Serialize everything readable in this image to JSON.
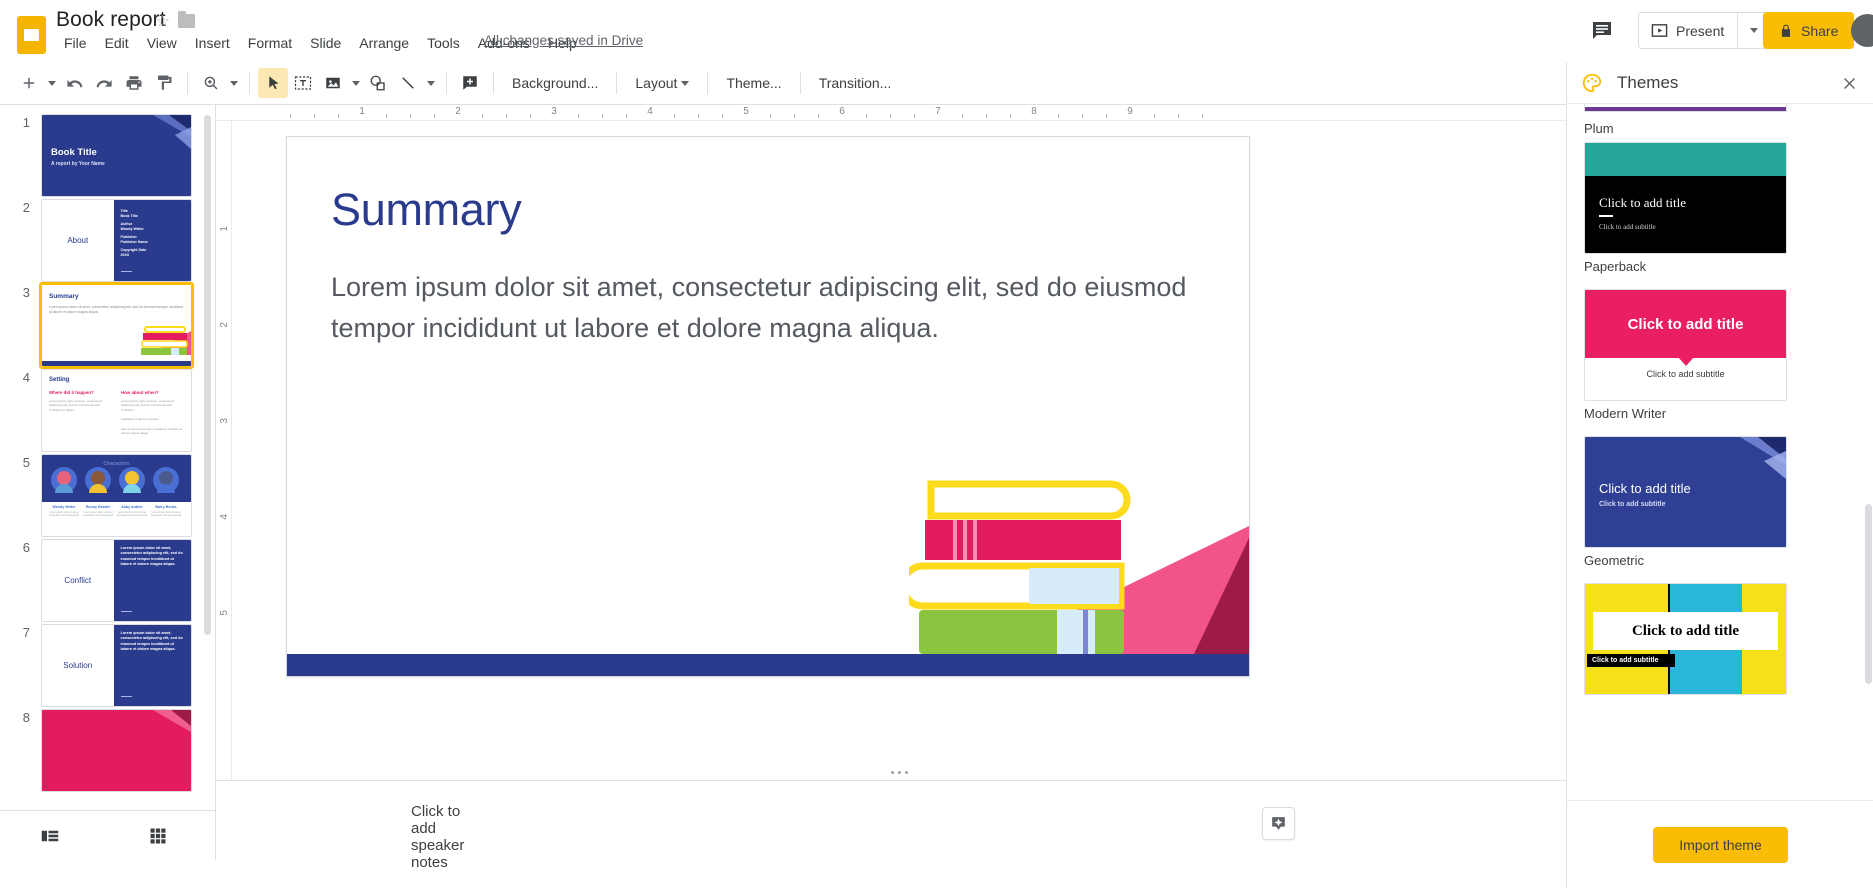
{
  "app": {
    "doc_title": "Book report",
    "save_status": "All changes saved in Drive"
  },
  "menus": [
    {
      "label": "File"
    },
    {
      "label": "Edit"
    },
    {
      "label": "View"
    },
    {
      "label": "Insert"
    },
    {
      "label": "Format"
    },
    {
      "label": "Slide"
    },
    {
      "label": "Arrange"
    },
    {
      "label": "Tools"
    },
    {
      "label": "Add-ons"
    },
    {
      "label": "Help"
    }
  ],
  "header": {
    "present_label": "Present",
    "share_label": "Share",
    "comment_icon": "comment-icon",
    "lock_icon": "lock-icon",
    "avatar_icon": "account-avatar"
  },
  "toolbar": {
    "new_slide_label": "+",
    "background_label": "Background...",
    "layout_label": "Layout",
    "theme_label": "Theme...",
    "transition_label": "Transition...",
    "icons": [
      "add-slide-icon",
      "undo-icon",
      "redo-icon",
      "print-icon",
      "paint-format-icon",
      "zoom-icon",
      "select-icon",
      "textbox-icon",
      "image-icon",
      "shape-icon",
      "line-icon",
      "comment-add-icon"
    ]
  },
  "ruler": {
    "h_labels": [
      "1",
      "2",
      "3",
      "4",
      "5",
      "6",
      "7",
      "8",
      "9"
    ],
    "v_labels": [
      "1",
      "2",
      "3",
      "4",
      "5"
    ]
  },
  "filmstrip": {
    "selected_index": 3,
    "view_filmstrip_icon": "filmstrip-view-icon",
    "view_grid_icon": "grid-view-icon",
    "slides": [
      {
        "num": "1",
        "kind": "title",
        "title": "Book Title",
        "subtitle": "A report by Your Name"
      },
      {
        "num": "2",
        "kind": "split",
        "title": "About",
        "fields": [
          "Title",
          "Book Title",
          "Author",
          "Woody Writer",
          "Publisher",
          "Publisher Name",
          "Copyright Date",
          "20XX"
        ]
      },
      {
        "num": "3",
        "kind": "summary",
        "title": "Summary",
        "body": "Lorem ipsum dolor sit amet, consectetur adipiscing elit, sed do eiusmod tempor incididunt ut labore et dolore magna aliqua."
      },
      {
        "num": "4",
        "kind": "setting",
        "title": "Setting",
        "col1": "Where did it happen?",
        "col2": "How about when?"
      },
      {
        "num": "5",
        "kind": "characters",
        "title": "Characters",
        "names": [
          "Wendy Writer",
          "Ronny Reader",
          "Abby Author",
          "Barry Books"
        ]
      },
      {
        "num": "6",
        "kind": "split",
        "title": "Conflict",
        "body": "Lorem ipsum dolor sit amet, consectetur adipiscing elit, sed do eiusmod tempor incididunt ut labore et dolore magna aliqua."
      },
      {
        "num": "7",
        "kind": "split",
        "title": "Solution",
        "body": "Lorem ipsum dolor sit amet, consectetur adipiscing elit, sed do eiusmod tempor incididunt ut labore et dolore magna aliqua."
      },
      {
        "num": "8",
        "kind": "pink",
        "title": ""
      }
    ]
  },
  "slide": {
    "title": "Summary",
    "body": "Lorem ipsum dolor sit amet, consectetur adipiscing elit, sed do eiusmod tempor incididunt ut labore et dolore magna aliqua.",
    "illustration": "stack-of-books-illustration"
  },
  "notes": {
    "placeholder": "Click to add speaker notes",
    "explore_icon": "explore-icon"
  },
  "themes": {
    "panel_title": "Themes",
    "palette_icon": "palette-icon",
    "close_icon": "close-icon",
    "import_label": "Import theme",
    "items": [
      {
        "name": "Plum",
        "style": "plum",
        "title": "",
        "subtitle": ""
      },
      {
        "name": "Paperback",
        "style": "paperback",
        "title": "Click to add title",
        "subtitle": "Click to add subtitle"
      },
      {
        "name": "Modern Writer",
        "style": "modern",
        "title": "Click to add title",
        "subtitle": "Click to add subtitle"
      },
      {
        "name": "Geometric",
        "style": "geometric",
        "title": "Click to add title",
        "subtitle": "Click to add subtitle"
      },
      {
        "name": "",
        "style": "blocks",
        "title": "Click to add title",
        "subtitle": "Click to add subtitle"
      }
    ]
  },
  "colors": {
    "brand_yellow": "#fbbc04",
    "slide_blue": "#2a3a8c",
    "theme_teal": "#26a69a",
    "theme_pink": "#e91e63",
    "theme_crimson": "#e91e63",
    "theme_cyan": "#29b6d8",
    "theme_yellow": "#f5e119",
    "body_gray": "#555a60"
  }
}
